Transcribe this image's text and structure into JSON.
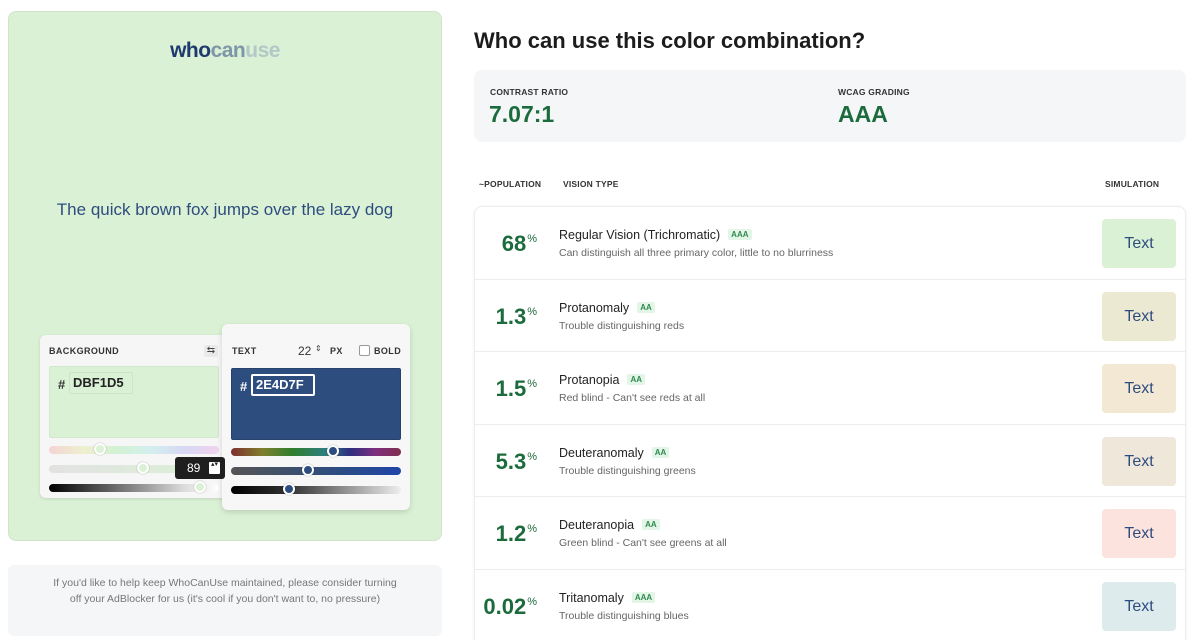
{
  "logo": {
    "part1": "who",
    "part2": "can",
    "part3": "use"
  },
  "preview": {
    "sample_text": "The quick brown fox jumps over the lazy dog",
    "background_color": "#DBF1D5",
    "text_color": "#2E4D7F"
  },
  "background_card": {
    "label": "BACKGROUND",
    "swap_icon": "⇆",
    "hash": "#",
    "hex_value": "DBF1D5",
    "hue_value": 0.3,
    "saturation_value": 0.55,
    "lightness_value": 89,
    "lightness_tooltip": "89",
    "spin_icon": "▴▾"
  },
  "text_card": {
    "label": "TEXT",
    "font_size": "22",
    "size_spin": "⇕",
    "px_label": "PX",
    "bold_label": "BOLD",
    "bold_checked": false,
    "hash": "#",
    "hex_value": "2E4D7F",
    "hue_value": 0.6,
    "saturation_value": 0.45,
    "lightness_value": 0.34
  },
  "ad_note": "If you'd like to help keep WhoCanUse maintained, please consider turning off your AdBlocker for us (it's cool if you don't want to, no pressure)",
  "main": {
    "title": "Who can use this color combination?",
    "contrast_label": "CONTRAST RATIO",
    "contrast_value": "7.07:1",
    "wcag_label": "WCAG GRADING",
    "wcag_value": "AAA",
    "columns": {
      "population": "~POPULATION",
      "vision_type": "VISION TYPE",
      "simulation": "SIMULATION"
    },
    "rows": [
      {
        "pct": "68",
        "sym": "%",
        "name": "Regular Vision (Trichromatic)",
        "grade": "AAA",
        "desc": "Can distinguish all three primary color, little to no blurriness",
        "sim_label": "Text",
        "sim_bg": "#dbf1d5"
      },
      {
        "pct": "1.3",
        "sym": "%",
        "name": "Protanomaly",
        "grade": "AA",
        "desc": "Trouble distinguishing reds",
        "sim_label": "Text",
        "sim_bg": "#ece9d3"
      },
      {
        "pct": "1.5",
        "sym": "%",
        "name": "Protanopia",
        "grade": "AA",
        "desc": "Red blind - Can't see reds at all",
        "sim_label": "Text",
        "sim_bg": "#f3e8d3"
      },
      {
        "pct": "5.3",
        "sym": "%",
        "name": "Deuteranomaly",
        "grade": "AA",
        "desc": "Trouble distinguishing greens",
        "sim_label": "Text",
        "sim_bg": "#efe7da"
      },
      {
        "pct": "1.2",
        "sym": "%",
        "name": "Deuteranopia",
        "grade": "AA",
        "desc": "Green blind - Can't see greens at all",
        "sim_label": "Text",
        "sim_bg": "#fde3dd"
      },
      {
        "pct": "0.02",
        "sym": "%",
        "name": "Tritanomaly",
        "grade": "AAA",
        "desc": "Trouble distinguishing blues",
        "sim_label": "Text",
        "sim_bg": "#ddebec"
      }
    ]
  }
}
